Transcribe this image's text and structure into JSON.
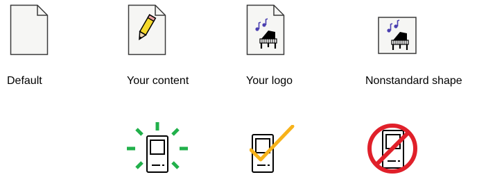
{
  "labels": {
    "default": "Default",
    "content": "Your content",
    "logo": "Your logo",
    "nonstandard": "Nonstandard shape"
  },
  "colors": {
    "page_fill": "#f6f6f4",
    "outline": "#3a3a3a",
    "pencil": "#f5d92b",
    "glow": "#21b04b",
    "check": "#f7b21a",
    "no_sign": "#e0202a",
    "note": "#4a3fb0"
  },
  "icons": [
    "default-document-icon",
    "pencil-document-icon",
    "piano-logo-document-icon",
    "piano-logo-square-icon",
    "handheld-device-glowing-icon",
    "handheld-device-checked-icon",
    "handheld-device-prohibited-icon"
  ]
}
